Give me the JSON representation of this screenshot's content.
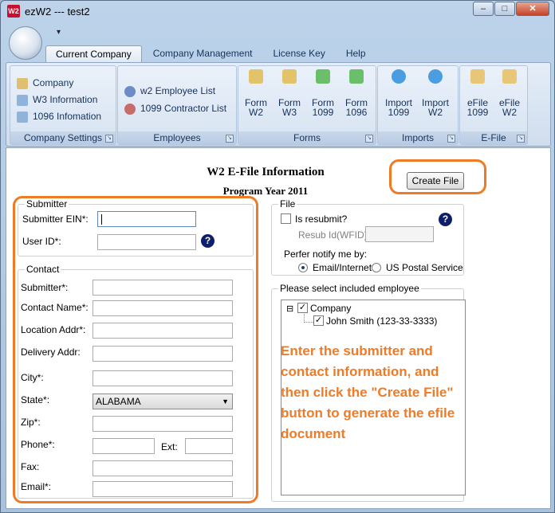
{
  "window": {
    "title": "ezW2 --- test2",
    "icon": "ezw2-app-icon",
    "controls": {
      "minimize": "–",
      "maximize": "□",
      "close": "✕"
    }
  },
  "qat": {
    "arrow": "▾"
  },
  "tabs": [
    {
      "label": "Current Company",
      "active": true
    },
    {
      "label": "Company Management"
    },
    {
      "label": "License Key"
    },
    {
      "label": "Help"
    }
  ],
  "ribbon": {
    "company_settings": {
      "label": "Company Settings",
      "items": [
        {
          "label": "Company",
          "icon": "home-icon"
        },
        {
          "label": "W3 Information",
          "icon": "document-icon"
        },
        {
          "label": "1096 Infomation",
          "icon": "document-icon"
        }
      ]
    },
    "employees": {
      "label": "Employees",
      "items": [
        {
          "label": "w2 Employee List",
          "icon": "user-icon"
        },
        {
          "label": "1099 Contractor List",
          "icon": "user-icon"
        }
      ]
    },
    "forms": {
      "label": "Forms",
      "items": [
        {
          "line1": "Form",
          "line2": "W2",
          "icon": "form-icon"
        },
        {
          "line1": "Form",
          "line2": "W3",
          "icon": "form-icon"
        },
        {
          "line1": "Form",
          "line2": "1099",
          "icon": "form-arrow-icon"
        },
        {
          "line1": "Form",
          "line2": "1096",
          "icon": "form-arrow-icon"
        }
      ]
    },
    "imports": {
      "label": "Imports",
      "items": [
        {
          "line1": "Import",
          "line2": "1099",
          "icon": "upload-icon"
        },
        {
          "line1": "Import",
          "line2": "W2",
          "icon": "upload-icon"
        }
      ]
    },
    "efile": {
      "label": "E-File",
      "items": [
        {
          "line1": "eFile",
          "line2": "1099",
          "icon": "efile-icon"
        },
        {
          "line1": "eFile",
          "line2": "W2",
          "icon": "efile-icon"
        }
      ]
    },
    "launcher_glyph": "↘"
  },
  "main": {
    "title": "W2 E-File Information",
    "subtitle": "Program Year 2011",
    "create_button": "Create File"
  },
  "submitter": {
    "legend": "Submitter",
    "ein_label": "Submitter EIN*:",
    "ein_value": "",
    "userid_label": "User ID*:",
    "userid_value": "",
    "help": "?"
  },
  "contact": {
    "legend": "Contact",
    "fields": {
      "submitter": "Submitter*:",
      "contact_name": "Contact Name*:",
      "location_addr": "Location Addr*:",
      "delivery_addr": "Delivery Addr:",
      "city": "City*:",
      "state": "State*:",
      "zip": "Zip*:",
      "phone": "Phone*:",
      "ext": "Ext:",
      "fax": "Fax:",
      "email": "Email*:"
    },
    "state_value": "ALABAMA"
  },
  "file": {
    "legend": "File",
    "resubmit_label": "Is resubmit?",
    "resubmit_checked": false,
    "resub_id_label": "Resub Id(WFID)",
    "notify_label": "Perfer notify me by:",
    "notify_options": [
      "Email/Internet",
      "US Postal Service"
    ],
    "notify_selected": "Email/Internet",
    "help": "?"
  },
  "employees_select": {
    "legend": "Please select included employee",
    "tree": [
      {
        "label": "Company",
        "checked": true,
        "expander": "⊟"
      },
      {
        "label": "John Smith (123-33-3333)",
        "checked": true
      }
    ]
  },
  "callout": "Enter the submitter and contact information, and then click the \"Create File\" button to generate the efile document",
  "colors": {
    "callout": "#ef7b26",
    "help_icon": "#0d1f6b"
  }
}
